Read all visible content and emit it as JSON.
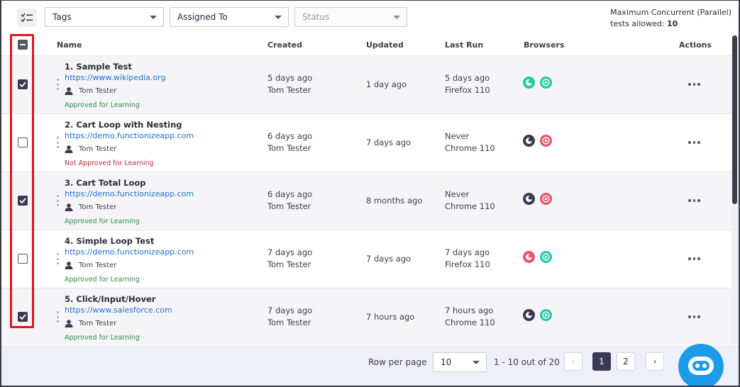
{
  "toolbar": {
    "filters": [
      {
        "label": "Tags",
        "disabled": false
      },
      {
        "label": "Assigned To",
        "disabled": false
      },
      {
        "label": "Status",
        "disabled": true
      }
    ],
    "concurrent_line1": "Maximum Concurrent (Parallel)",
    "concurrent_line2_label": "tests allowed:",
    "concurrent_value": "10"
  },
  "table": {
    "headers": {
      "name": "Name",
      "created": "Created",
      "updated": "Updated",
      "last_run": "Last Run",
      "browsers": "Browsers",
      "actions": "Actions"
    },
    "rows": [
      {
        "checked": true,
        "name": "1. Sample Test",
        "url": "https://www.wikipedia.org",
        "owner": "Tom Tester",
        "approval": "Approved for Learning",
        "approved": true,
        "created": "5 days ago",
        "created_by": "Tom Tester",
        "updated": "1 day ago",
        "last_run": "5 days ago",
        "last_run_browser": "Firefox 110",
        "browsers": [
          {
            "icon": "firefox-icon",
            "color": "#27c9a6"
          },
          {
            "icon": "chrome-icon",
            "color": "#27c9a6"
          }
        ]
      },
      {
        "checked": false,
        "name": "2. Cart Loop with Nesting",
        "url": "https://demo.functionizeapp.com",
        "owner": "Tom Tester",
        "approval": "Not Approved for Learning",
        "approved": false,
        "created": "6 days ago",
        "created_by": "Tom Tester",
        "updated": "7 days ago",
        "last_run": "Never",
        "last_run_browser": "Chrome 110",
        "browsers": [
          {
            "icon": "firefox-icon",
            "color": "#3b3a52"
          },
          {
            "icon": "chrome-icon",
            "color": "#e8556b"
          }
        ]
      },
      {
        "checked": true,
        "name": "3. Cart Total Loop",
        "url": "https://demo.functionizeapp.com",
        "owner": "Tom Tester",
        "approval": "Approved for Learning",
        "approved": true,
        "created": "6 days ago",
        "created_by": "Tom Tester",
        "updated": "8 months ago",
        "last_run": "Never",
        "last_run_browser": "Chrome 110",
        "browsers": [
          {
            "icon": "firefox-icon",
            "color": "#3b3a52"
          },
          {
            "icon": "chrome-icon",
            "color": "#e8556b"
          }
        ]
      },
      {
        "checked": false,
        "name": "4. Simple Loop Test",
        "url": "https://demo.functionizeapp.com",
        "owner": "Tom Tester",
        "approval": "Approved for Learning",
        "approved": true,
        "created": "7 days ago",
        "created_by": "Tom Tester",
        "updated": "7 days ago",
        "last_run": "7 days ago",
        "last_run_browser": "Firefox 110",
        "browsers": [
          {
            "icon": "firefox-icon",
            "color": "#e8556b"
          },
          {
            "icon": "chrome-icon",
            "color": "#27c9a6"
          }
        ]
      },
      {
        "checked": true,
        "name": "5. Click/Input/Hover",
        "url": "https://www.salesforce.com",
        "owner": "Tom Tester",
        "approval": "Approved for Learning",
        "approved": true,
        "created": "7 days ago",
        "created_by": "Tom Tester",
        "updated": "7 hours ago",
        "last_run": "7 hours ago",
        "last_run_browser": "Chrome 110",
        "browsers": [
          {
            "icon": "firefox-icon",
            "color": "#3b3a52"
          },
          {
            "icon": "chrome-icon",
            "color": "#27c9a6"
          }
        ]
      }
    ]
  },
  "footer": {
    "rows_per_page_label": "Row per page",
    "rows_per_page_value": "10",
    "range": "1 - 10 out of 20",
    "pages": [
      "1",
      "2"
    ],
    "current_page": "1",
    "prev": "‹",
    "next": "›"
  },
  "colors": {
    "accent": "#3b3a52",
    "link": "#1f6fd0",
    "approved": "#2e8b4a",
    "not_approved": "#c2283a",
    "highlight": "#e1141f",
    "bot": "#1e9be8"
  }
}
